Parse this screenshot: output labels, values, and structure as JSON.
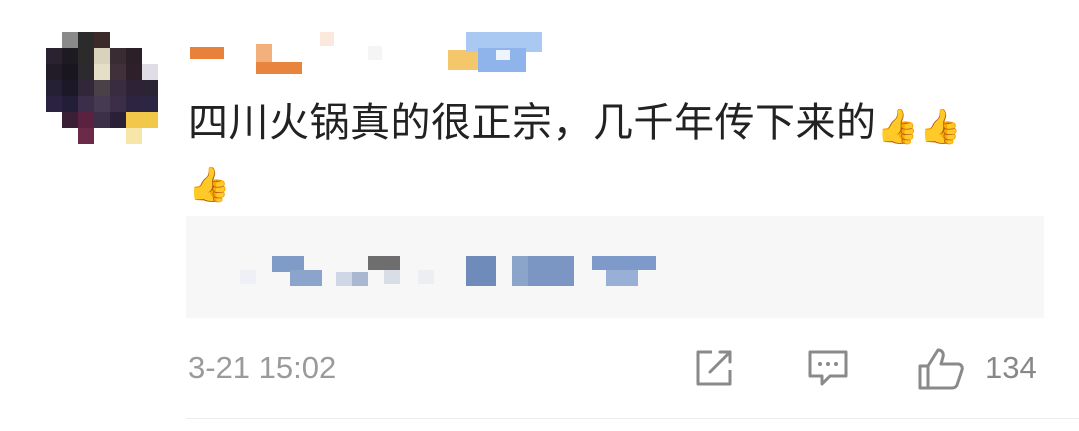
{
  "comment": {
    "text": "四川火锅真的很正宗，几千年传下来的",
    "emojis": [
      "👍",
      "👍",
      "👍"
    ],
    "emoji_name": "thumbs-up"
  },
  "meta": {
    "timestamp": "3-21 15:02",
    "like_count": "134"
  },
  "icons": {
    "share": "share-edit-icon",
    "reply": "comment-bubble-icon",
    "like": "thumbs-up-outline-icon"
  },
  "colors": {
    "text": "#222222",
    "muted": "#9a9a9a",
    "quote_bg": "#f7f7f7"
  }
}
